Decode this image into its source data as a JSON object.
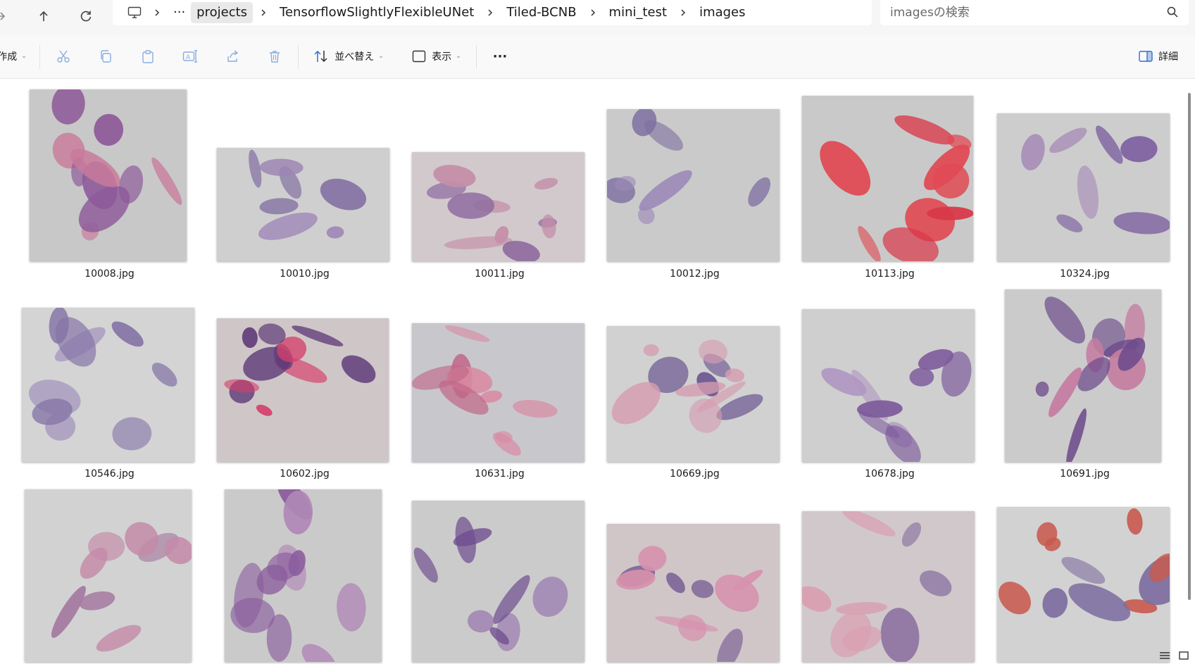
{
  "window": {
    "title": "images"
  },
  "address": {
    "breadcrumbs": [
      "projects",
      "TensorflowSlightlyFlexibleUNet",
      "Tiled-BCNB",
      "mini_test",
      "images"
    ],
    "overflow_label": "···"
  },
  "search": {
    "placeholder": "imagesの検索"
  },
  "toolbar": {
    "new_label": "作成",
    "sort_label": "並べ替え",
    "view_label": "表示",
    "more_label": "···",
    "details_label": "詳細"
  },
  "files": [
    {
      "name": "10008.jpg",
      "bg": "#c8c8c8",
      "stain": "#8e5a9a",
      "stain2": "#c97a9a"
    },
    {
      "name": "10010.jpg",
      "bg": "#cfcfcf",
      "stain": "#7e6aa0",
      "stain2": "#9d84b5"
    },
    {
      "name": "10011.jpg",
      "bg": "#d2c9cc",
      "stain": "#c48ea8",
      "stain2": "#8e6aa0"
    },
    {
      "name": "10012.jpg",
      "bg": "#cacaca",
      "stain": "#7d6ea0",
      "stain2": "#9c8bb8"
    },
    {
      "name": "10113.jpg",
      "bg": "#c9c9c9",
      "stain": "#e04a54",
      "stain2": "#d83848"
    },
    {
      "name": "10324.jpg",
      "bg": "#cdcdcd",
      "stain": "#7a5c9e",
      "stain2": "#a68bb6"
    },
    {
      "name": "10546.jpg",
      "bg": "#d4d4d4",
      "stain": "#8474a6",
      "stain2": "#a89cc0"
    },
    {
      "name": "10602.jpg",
      "bg": "#cfc6c8",
      "stain": "#5e3a78",
      "stain2": "#d4406c"
    },
    {
      "name": "10631.jpg",
      "bg": "#c8c8cc",
      "stain": "#d98aa2",
      "stain2": "#c06888"
    },
    {
      "name": "10669.jpg",
      "bg": "#d1d1d1",
      "stain": "#d59cb0",
      "stain2": "#6e5a92"
    },
    {
      "name": "10678.jpg",
      "bg": "#cfcfcf",
      "stain": "#7e5c9c",
      "stain2": "#b098c2"
    },
    {
      "name": "10691.jpg",
      "bg": "#cbcbcb",
      "stain": "#6e4c8c",
      "stain2": "#c57ca0"
    },
    {
      "name": "",
      "bg": "#d2d2d2",
      "stain": "#c48aa8",
      "stain2": "#a57aa0"
    },
    {
      "name": "",
      "bg": "#cacaca",
      "stain": "#8a5c9c",
      "stain2": "#b088b6"
    },
    {
      "name": "",
      "bg": "#cbcbcb",
      "stain": "#6e4c8e",
      "stain2": "#9a7ab0"
    },
    {
      "name": "",
      "bg": "#d0c6c8",
      "stain": "#d791ad",
      "stain2": "#7c6496"
    },
    {
      "name": "",
      "bg": "#d1c8cb",
      "stain": "#d99fb1",
      "stain2": "#8a70a0"
    },
    {
      "name": "",
      "bg": "#d2d2d2",
      "stain": "#c85a4e",
      "stain2": "#7e6ea0"
    }
  ]
}
